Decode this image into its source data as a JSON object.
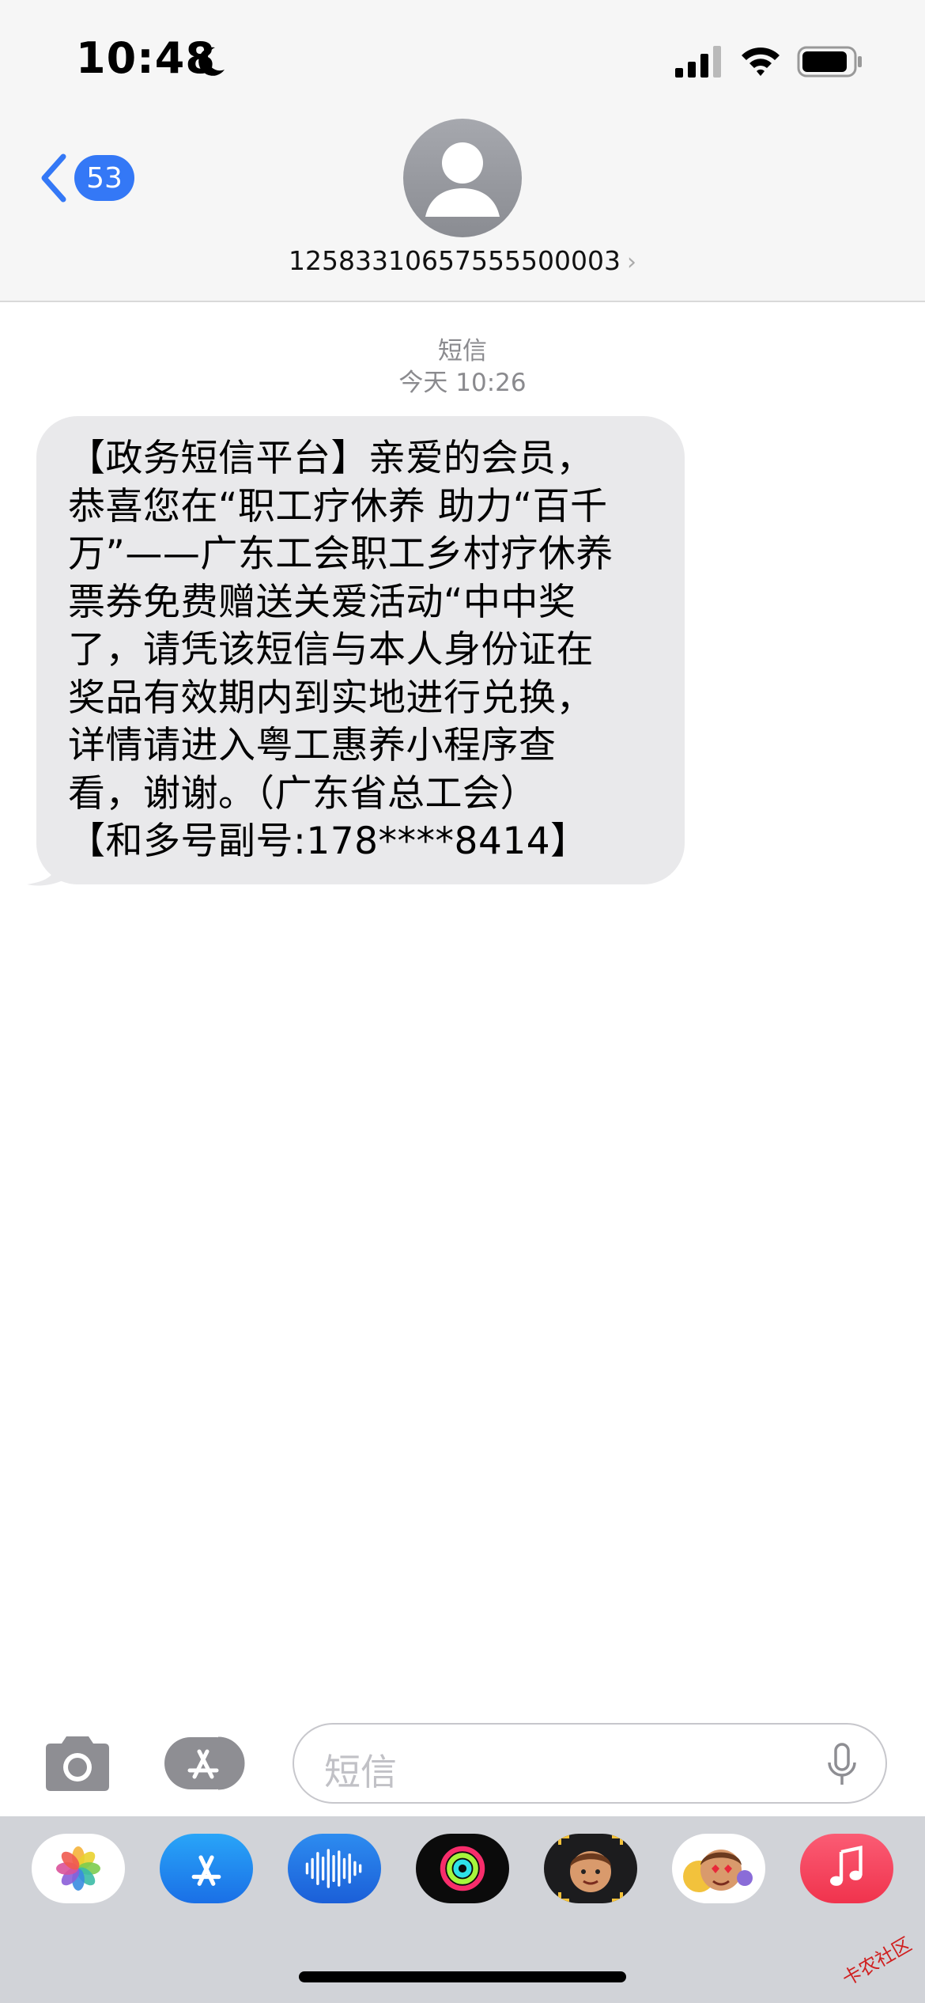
{
  "status_bar": {
    "time": "10:48"
  },
  "nav": {
    "back_count": "53",
    "contact": "12583310657555500003",
    "contact_chevron": "›"
  },
  "conversation": {
    "service": "短信",
    "timestamp": "今天 10:26",
    "message": "【政务短信平台】亲爱的会员，\n恭喜您在“职工疗休养 助力“百千\n万”——广东工会职工乡村疗休养\n票券免费赠送关爱活动“中中奖\n了，请凭该短信与本人身份证在\n奖品有效期内到实地进行兑换，\n详情请进入粤工惠养小程序查\n看，谢谢。（广东省总工会）\n【和多号副号:178****8414】"
  },
  "composer": {
    "placeholder": "短信"
  },
  "drawer_apps": [
    "photos-icon",
    "app-store-icon",
    "audio-message-icon",
    "activity-icon",
    "memoji-icon",
    "memoji-stickers-icon",
    "music-icon"
  ],
  "watermark": "卡农社区",
  "colors": {
    "accent": "#3478f6",
    "bubble": "#e9e9eb",
    "header_bg": "#f6f6f6",
    "drawer_bg": "#d1d3d8"
  }
}
